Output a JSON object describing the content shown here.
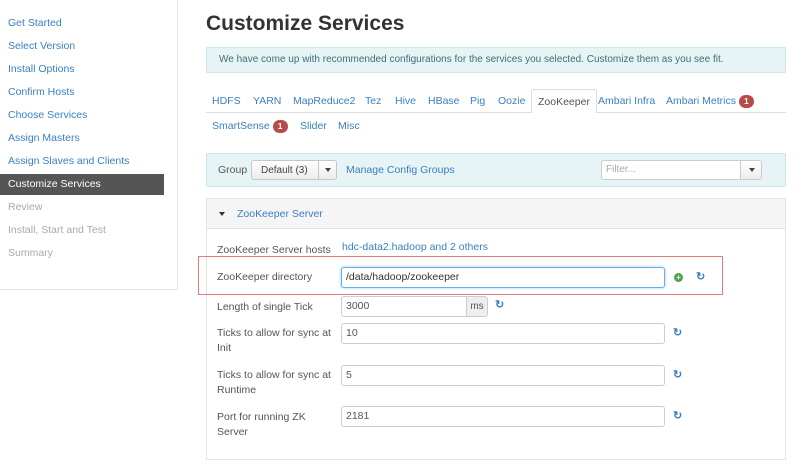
{
  "sidebar": {
    "header": "",
    "items": [
      {
        "label": "Get Started",
        "state": "link"
      },
      {
        "label": "Select Version",
        "state": "link"
      },
      {
        "label": "Install Options",
        "state": "link"
      },
      {
        "label": "Confirm Hosts",
        "state": "link"
      },
      {
        "label": "Choose Services",
        "state": "link"
      },
      {
        "label": "Assign Masters",
        "state": "link"
      },
      {
        "label": "Assign Slaves and Clients",
        "state": "link"
      },
      {
        "label": "Customize Services",
        "state": "active"
      },
      {
        "label": "Review",
        "state": "disabled"
      },
      {
        "label": "Install, Start and Test",
        "state": "disabled"
      },
      {
        "label": "Summary",
        "state": "disabled"
      }
    ]
  },
  "main": {
    "title": "Customize Services",
    "banner": "We have come up with recommended configurations for the services you selected. Customize them as you see fit.",
    "tabs": [
      {
        "label": "HDFS"
      },
      {
        "label": "YARN"
      },
      {
        "label": "MapReduce2"
      },
      {
        "label": "Tez"
      },
      {
        "label": "Hive"
      },
      {
        "label": "HBase"
      },
      {
        "label": "Pig"
      },
      {
        "label": "Oozie"
      },
      {
        "label": "ZooKeeper",
        "active": true
      },
      {
        "label": "Ambari Infra"
      },
      {
        "label": "Ambari Metrics",
        "badge": "1"
      },
      {
        "label": "SmartSense",
        "badge": "1"
      },
      {
        "label": "Slider"
      },
      {
        "label": "Misc"
      }
    ],
    "group": {
      "label": "Group",
      "selected": "Default (3)",
      "manage_link": "Manage Config Groups",
      "filter_placeholder": "Filter..."
    },
    "section": {
      "title": "ZooKeeper Server",
      "server_hosts_label": "ZooKeeper Server hosts",
      "server_hosts_value": "hdc-data2.hadoop and 2 others",
      "fields": {
        "directory": {
          "label": "ZooKeeper directory",
          "value": "/data/hadoop/zookeeper"
        },
        "tick": {
          "label": "Length of single Tick",
          "value": "3000",
          "unit": "ms"
        },
        "init": {
          "label": "Ticks to allow for sync at Init",
          "value": "10"
        },
        "runtime": {
          "label": "Ticks to allow for sync at Runtime",
          "value": "5"
        },
        "port": {
          "label": "Port for running ZK Server",
          "value": "2181"
        }
      }
    }
  },
  "icons": {
    "undo": "undo-icon",
    "add": "plus-icon",
    "caret": "caret-down-icon"
  },
  "colors": {
    "link": "#3a7fc0",
    "active_sidebar": "#555555",
    "banner_bg": "#e6f4f6",
    "highlight": "#e27b7b",
    "badge": "#b94a48"
  }
}
